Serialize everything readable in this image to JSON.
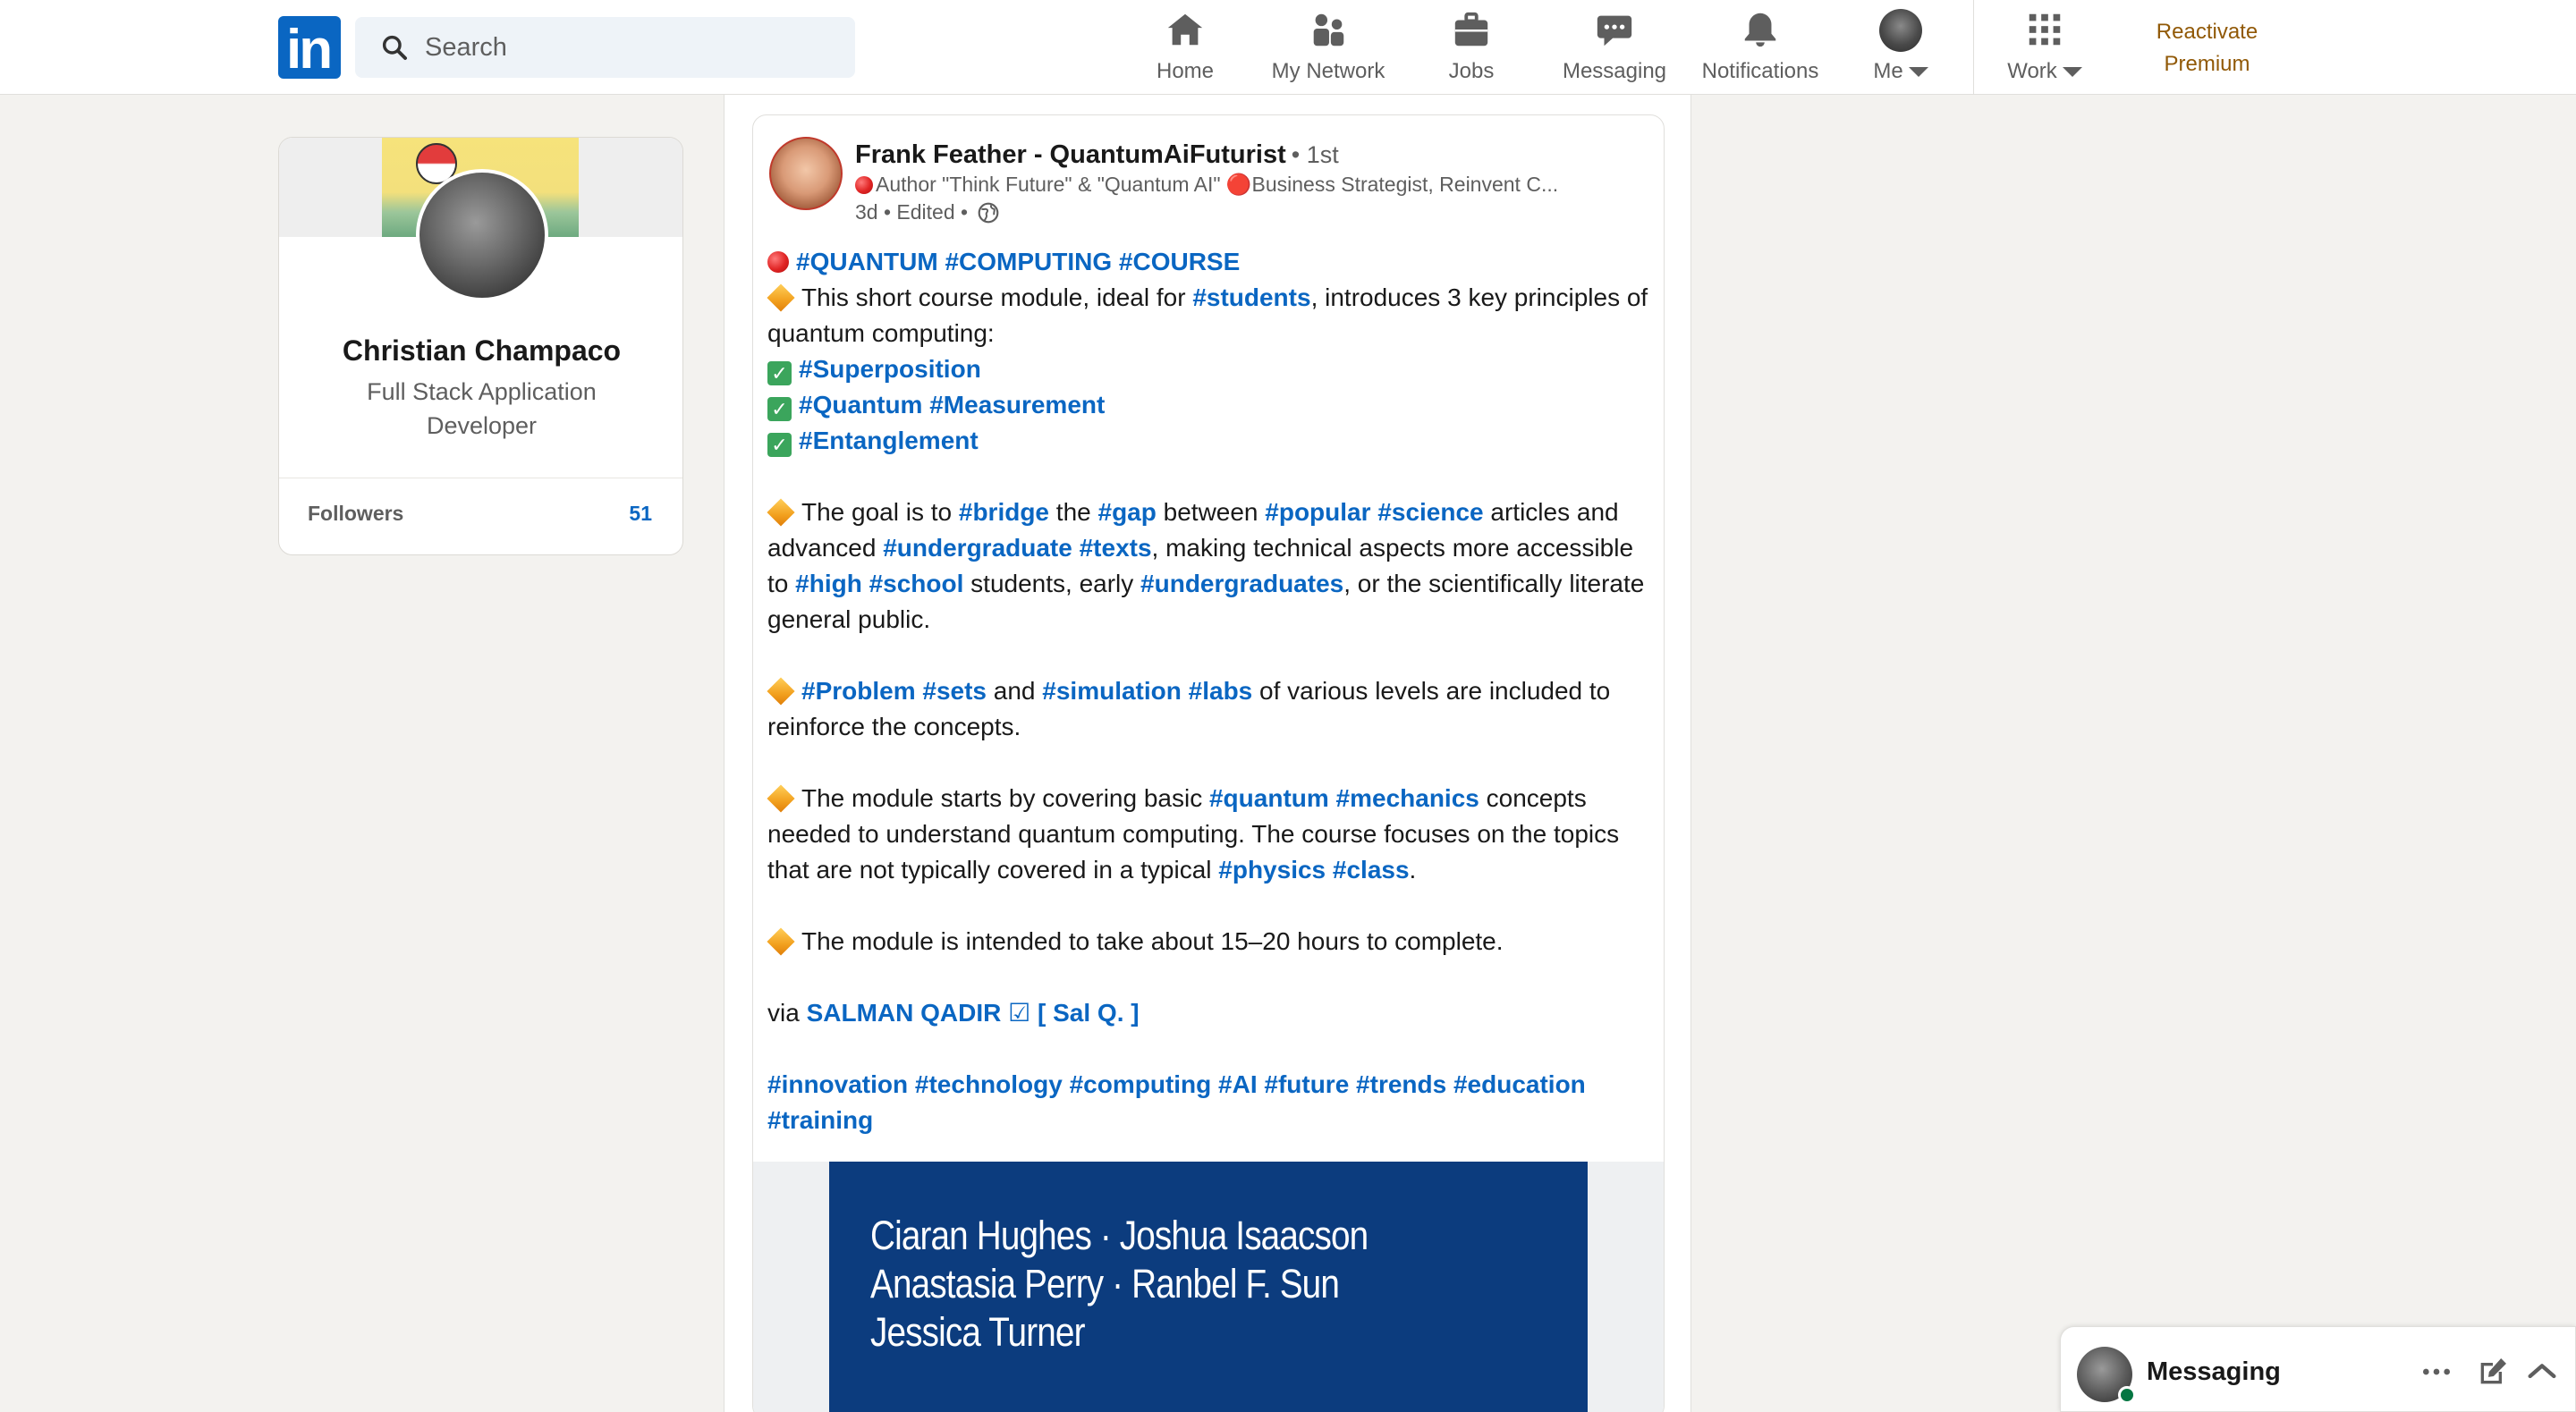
{
  "nav": {
    "logo_text": "in",
    "search_placeholder": "Search",
    "items": [
      {
        "label": "Home",
        "icon": "home-icon"
      },
      {
        "label": "My Network",
        "icon": "my-network-icon"
      },
      {
        "label": "Jobs",
        "icon": "jobs-icon"
      },
      {
        "label": "Messaging",
        "icon": "messaging-icon"
      },
      {
        "label": "Notifications",
        "icon": "notifications-icon"
      },
      {
        "label": "Me",
        "icon": "me-avatar"
      },
      {
        "label": "Work",
        "icon": "grid-icon"
      }
    ],
    "premium_line1": "Reactivate",
    "premium_line2": "Premium"
  },
  "profile": {
    "name": "Christian Champaco",
    "headline": "Full Stack Application Developer",
    "followers_label": "Followers",
    "followers_count": "51"
  },
  "post": {
    "author_name": "Frank Feather - QuantumAiFuturist",
    "degree": "• 1st",
    "headline": "Author \"Think Future\" & \"Quantum AI\" 🔴Business Strategist, Reinvent C...",
    "meta": "3d • Edited •",
    "line_title": "#QUANTUM #COMPUTING #COURSE",
    "p1_text_a": "This short course module, ideal for ",
    "p1_tag": "#students",
    "p1_text_b": ", introduces 3 key principles of quantum computing:",
    "check1": "#Superposition",
    "check2": "#Quantum #Measurement",
    "check3": "#Entanglement",
    "p2": {
      "t1": "The goal is to ",
      "g1": "#bridge",
      "t2": " the ",
      "g2": "#gap",
      "t3": " between ",
      "g3": "#popular #science",
      "t4": " articles and advanced ",
      "g4": "#undergraduate #texts",
      "t5": ", making technical aspects more accessible to ",
      "g5": "#high #school",
      "t6": " students, early ",
      "g6": "#undergraduates",
      "t7": ", or the scientifically literate general public."
    },
    "p3": {
      "g1": "#Problem #sets",
      "t1": " and ",
      "g2": "#simulation #labs",
      "t2": " of various levels are included to reinforce the concepts."
    },
    "p4": {
      "t1": "The module starts by covering basic ",
      "g1": "#quantum #mechanics",
      "t2": " concepts needed to understand quantum computing. The course focuses on the topics that are not typically covered in a typical ",
      "g2": "#physics #class",
      "t3": "."
    },
    "p5": "The module is intended to take about 15–20 hours to complete.",
    "via_text": "via ",
    "via_link": "SALMAN QADIR ☑ [ Sal Q. ]",
    "footer_tags": "#innovation #technology #computing #AI #future #trends #education #training",
    "book_line1": "Ciaran Hughes · Joshua Isaacson",
    "book_line2": "Anastasia Perry · Ranbel F. Sun",
    "book_line3": "Jessica Turner"
  },
  "messaging_dock": {
    "title": "Messaging"
  },
  "colors": {
    "brand": "#0a66c2",
    "premium": "#915907",
    "book_cover": "#0c3c7e",
    "online": "#057642"
  }
}
